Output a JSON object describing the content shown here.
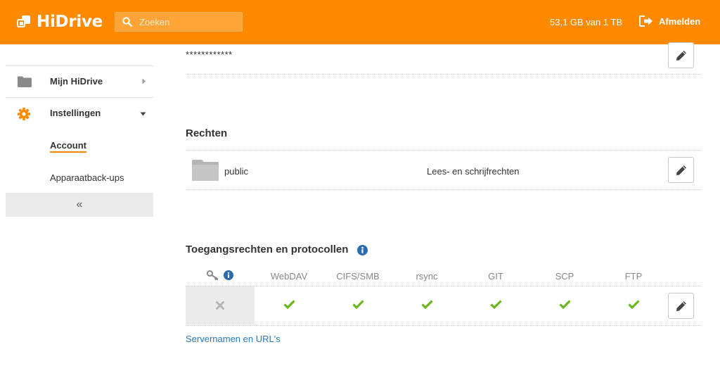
{
  "header": {
    "logo_text": "HiDrive",
    "search_placeholder": "Zoeken",
    "quota": "53,1 GB van 1 TB",
    "logout_label": "Afmelden"
  },
  "sidebar": {
    "items": [
      {
        "label": "Mijn HiDrive",
        "icon": "folder-icon"
      },
      {
        "label": "Instellingen",
        "icon": "gear-icon"
      }
    ],
    "sub_items": [
      {
        "label": "Account",
        "active": true
      },
      {
        "label": "Apparaatback-ups",
        "active": false
      }
    ],
    "collapse_label": "«"
  },
  "main": {
    "password_mask": "************",
    "rights_title": "Rechten",
    "folder": {
      "name": "public",
      "rights": "Lees- en schrijfrechten"
    },
    "access_title": "Toegangsrechten en protocollen",
    "protocols": [
      "WebDAV",
      "CIFS/SMB",
      "rsync",
      "GIT",
      "SCP",
      "FTP"
    ],
    "protocol_enabled": [
      true,
      true,
      true,
      true,
      true,
      true
    ],
    "server_link": "Servernamen en URL's"
  },
  "colors": {
    "brand": "#ff8a00",
    "check": "#6cb61e",
    "link": "#2b78b8",
    "info": "#2b6cb0"
  }
}
